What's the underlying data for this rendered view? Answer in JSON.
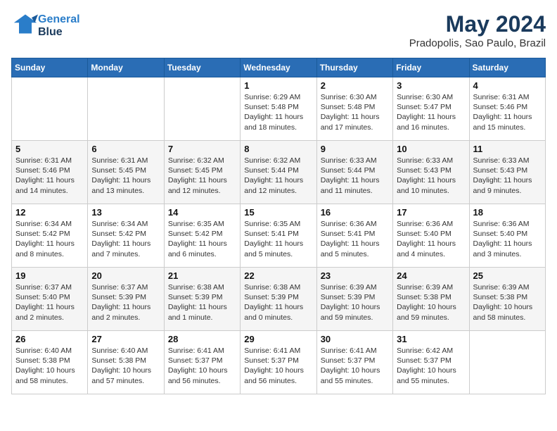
{
  "header": {
    "logo_line1": "General",
    "logo_line2": "Blue",
    "title": "May 2024",
    "subtitle": "Pradopolis, Sao Paulo, Brazil"
  },
  "calendar": {
    "days_of_week": [
      "Sunday",
      "Monday",
      "Tuesday",
      "Wednesday",
      "Thursday",
      "Friday",
      "Saturday"
    ],
    "weeks": [
      [
        {
          "num": "",
          "info": ""
        },
        {
          "num": "",
          "info": ""
        },
        {
          "num": "",
          "info": ""
        },
        {
          "num": "1",
          "info": "Sunrise: 6:29 AM\nSunset: 5:48 PM\nDaylight: 11 hours and 18 minutes."
        },
        {
          "num": "2",
          "info": "Sunrise: 6:30 AM\nSunset: 5:48 PM\nDaylight: 11 hours and 17 minutes."
        },
        {
          "num": "3",
          "info": "Sunrise: 6:30 AM\nSunset: 5:47 PM\nDaylight: 11 hours and 16 minutes."
        },
        {
          "num": "4",
          "info": "Sunrise: 6:31 AM\nSunset: 5:46 PM\nDaylight: 11 hours and 15 minutes."
        }
      ],
      [
        {
          "num": "5",
          "info": "Sunrise: 6:31 AM\nSunset: 5:46 PM\nDaylight: 11 hours and 14 minutes."
        },
        {
          "num": "6",
          "info": "Sunrise: 6:31 AM\nSunset: 5:45 PM\nDaylight: 11 hours and 13 minutes."
        },
        {
          "num": "7",
          "info": "Sunrise: 6:32 AM\nSunset: 5:45 PM\nDaylight: 11 hours and 12 minutes."
        },
        {
          "num": "8",
          "info": "Sunrise: 6:32 AM\nSunset: 5:44 PM\nDaylight: 11 hours and 12 minutes."
        },
        {
          "num": "9",
          "info": "Sunrise: 6:33 AM\nSunset: 5:44 PM\nDaylight: 11 hours and 11 minutes."
        },
        {
          "num": "10",
          "info": "Sunrise: 6:33 AM\nSunset: 5:43 PM\nDaylight: 11 hours and 10 minutes."
        },
        {
          "num": "11",
          "info": "Sunrise: 6:33 AM\nSunset: 5:43 PM\nDaylight: 11 hours and 9 minutes."
        }
      ],
      [
        {
          "num": "12",
          "info": "Sunrise: 6:34 AM\nSunset: 5:42 PM\nDaylight: 11 hours and 8 minutes."
        },
        {
          "num": "13",
          "info": "Sunrise: 6:34 AM\nSunset: 5:42 PM\nDaylight: 11 hours and 7 minutes."
        },
        {
          "num": "14",
          "info": "Sunrise: 6:35 AM\nSunset: 5:42 PM\nDaylight: 11 hours and 6 minutes."
        },
        {
          "num": "15",
          "info": "Sunrise: 6:35 AM\nSunset: 5:41 PM\nDaylight: 11 hours and 5 minutes."
        },
        {
          "num": "16",
          "info": "Sunrise: 6:36 AM\nSunset: 5:41 PM\nDaylight: 11 hours and 5 minutes."
        },
        {
          "num": "17",
          "info": "Sunrise: 6:36 AM\nSunset: 5:40 PM\nDaylight: 11 hours and 4 minutes."
        },
        {
          "num": "18",
          "info": "Sunrise: 6:36 AM\nSunset: 5:40 PM\nDaylight: 11 hours and 3 minutes."
        }
      ],
      [
        {
          "num": "19",
          "info": "Sunrise: 6:37 AM\nSunset: 5:40 PM\nDaylight: 11 hours and 2 minutes."
        },
        {
          "num": "20",
          "info": "Sunrise: 6:37 AM\nSunset: 5:39 PM\nDaylight: 11 hours and 2 minutes."
        },
        {
          "num": "21",
          "info": "Sunrise: 6:38 AM\nSunset: 5:39 PM\nDaylight: 11 hours and 1 minute."
        },
        {
          "num": "22",
          "info": "Sunrise: 6:38 AM\nSunset: 5:39 PM\nDaylight: 11 hours and 0 minutes."
        },
        {
          "num": "23",
          "info": "Sunrise: 6:39 AM\nSunset: 5:39 PM\nDaylight: 10 hours and 59 minutes."
        },
        {
          "num": "24",
          "info": "Sunrise: 6:39 AM\nSunset: 5:38 PM\nDaylight: 10 hours and 59 minutes."
        },
        {
          "num": "25",
          "info": "Sunrise: 6:39 AM\nSunset: 5:38 PM\nDaylight: 10 hours and 58 minutes."
        }
      ],
      [
        {
          "num": "26",
          "info": "Sunrise: 6:40 AM\nSunset: 5:38 PM\nDaylight: 10 hours and 58 minutes."
        },
        {
          "num": "27",
          "info": "Sunrise: 6:40 AM\nSunset: 5:38 PM\nDaylight: 10 hours and 57 minutes."
        },
        {
          "num": "28",
          "info": "Sunrise: 6:41 AM\nSunset: 5:37 PM\nDaylight: 10 hours and 56 minutes."
        },
        {
          "num": "29",
          "info": "Sunrise: 6:41 AM\nSunset: 5:37 PM\nDaylight: 10 hours and 56 minutes."
        },
        {
          "num": "30",
          "info": "Sunrise: 6:41 AM\nSunset: 5:37 PM\nDaylight: 10 hours and 55 minutes."
        },
        {
          "num": "31",
          "info": "Sunrise: 6:42 AM\nSunset: 5:37 PM\nDaylight: 10 hours and 55 minutes."
        },
        {
          "num": "",
          "info": ""
        }
      ]
    ]
  }
}
